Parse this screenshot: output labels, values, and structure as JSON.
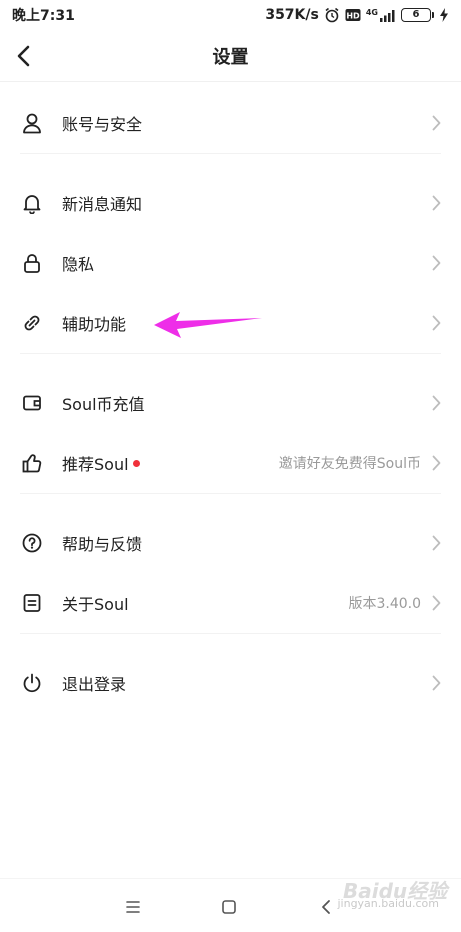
{
  "status": {
    "time": "晚上7:31",
    "speed": "357K/s",
    "network": "4G",
    "battery": "6"
  },
  "header": {
    "title": "设置"
  },
  "menu": {
    "account_security": "账号与安全",
    "notifications": "新消息通知",
    "privacy": "隐私",
    "accessibility": "辅助功能",
    "recharge": "Soul币充值",
    "recommend": "推荐Soul",
    "recommend_value": "邀请好友免费得Soul币",
    "help_feedback": "帮助与反馈",
    "about": "关于Soul",
    "about_value": "版本3.40.0",
    "logout": "退出登录"
  },
  "colors": {
    "annotation_arrow": "#ee2ee8",
    "red_dot": "#f0303a"
  },
  "watermark": {
    "logo": "Baidu经验",
    "url": "jingyan.baidu.com"
  }
}
